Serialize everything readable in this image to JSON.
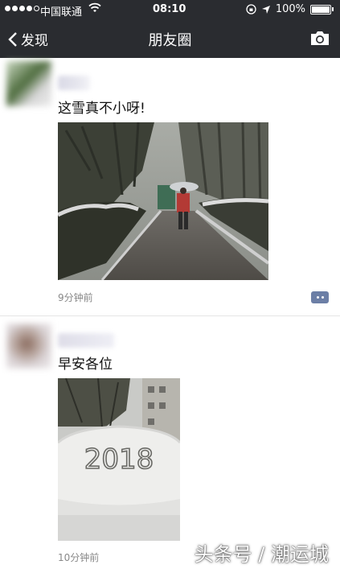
{
  "status_bar": {
    "carrier": "中国联通",
    "time": "08:10",
    "battery": "100%"
  },
  "nav": {
    "back_label": "发现",
    "title": "朋友圈"
  },
  "posts": [
    {
      "text": "这雪真不小呀!",
      "time": "9分钟前"
    },
    {
      "text": "早安各位",
      "time": "10分钟前",
      "photo_text": "2018"
    }
  ],
  "watermark": "头条号 / 潮运城",
  "icons": {
    "back": "chevron-left-icon",
    "camera": "camera-icon",
    "wifi": "wifi-icon",
    "location": "location-arrow-icon",
    "lock": "rotation-lock-icon",
    "comment": "comment-icon"
  }
}
